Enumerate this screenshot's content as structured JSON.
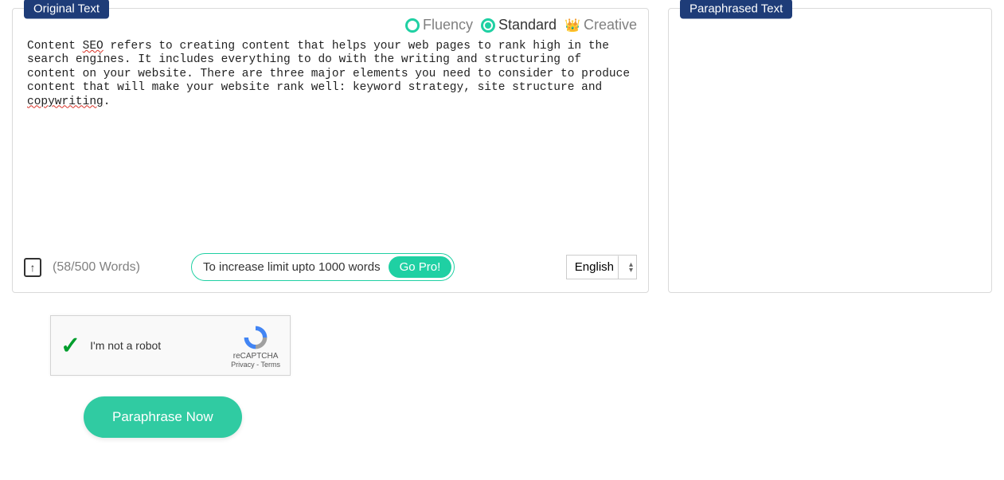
{
  "originalPanel": {
    "label": "Original Text",
    "modes": {
      "fluency": "Fluency",
      "standard": "Standard",
      "creative": "Creative"
    },
    "content": {
      "prefix": "Content ",
      "seo": "SEO",
      "mid": " refers to creating content that helps your web pages to rank high in the search engines. It includes everything to do with the writing and structuring of content on your website. There are three major elements you need to consider to produce content that will make your website rank well: keyword strategy, site structure and ",
      "copywriting": "copywriting",
      "suffix": "."
    },
    "wordCount": "(58/500 Words)",
    "proPill": {
      "text": "To increase limit upto 1000 words",
      "button": "Go Pro!"
    },
    "language": "English"
  },
  "paraphrasedPanel": {
    "label": "Paraphrased Text"
  },
  "recaptcha": {
    "robotText": "I'm not a robot",
    "brand": "reCAPTCHA",
    "links": "Privacy - Terms"
  },
  "paraphraseButton": "Paraphrase Now"
}
